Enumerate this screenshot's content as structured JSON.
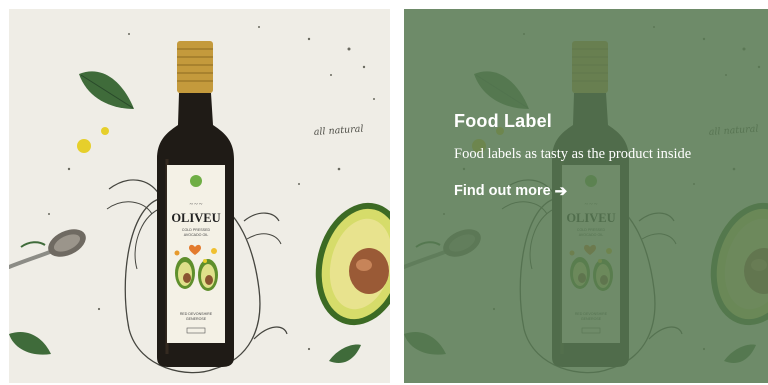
{
  "cards": [
    {
      "image": {
        "bottle_brand": "OLIVEU",
        "bottle_subtitle": "COLD PRESSED AVOCADO OIL",
        "bottle_footer": "RED DEVONSHIRE GENEROSE",
        "handwritten_note": "all natural"
      }
    },
    {
      "overlay_color": "#587a54",
      "title": "Food Label",
      "description": "Food labels as tasty as the product inside",
      "link_label": "Find out more",
      "link_icon": "arrow-right-icon"
    }
  ]
}
